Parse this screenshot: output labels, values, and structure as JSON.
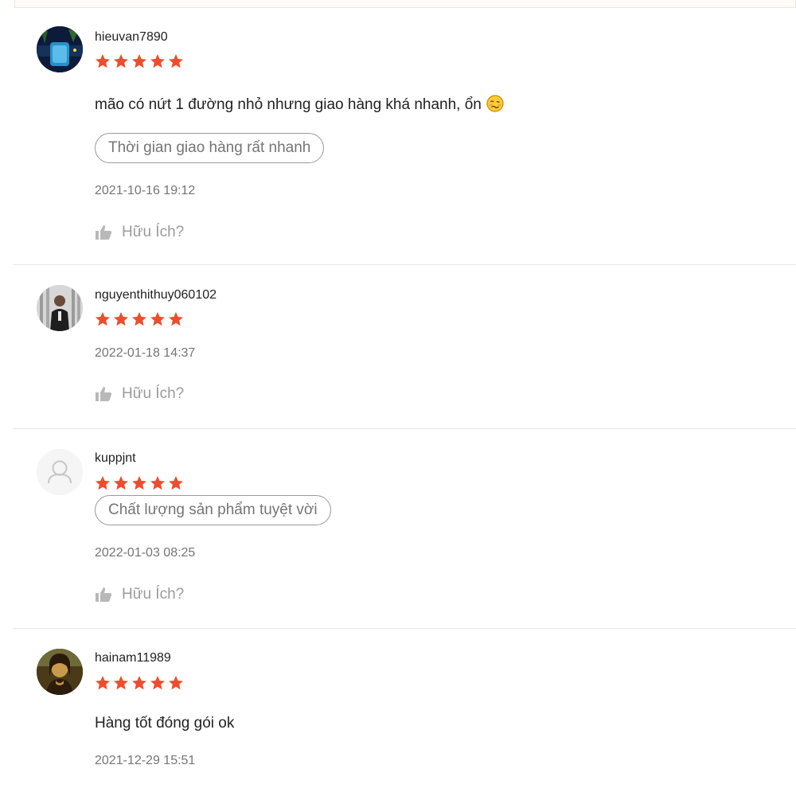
{
  "reviews": [
    {
      "username": "hieuvan7890",
      "rating": 5,
      "comment": "mão có nứt 1 đường nhỏ nhưng giao hàng khá nhanh, ổn",
      "tag": "Thời gian giao hàng rất nhanh",
      "timestamp": "2021-10-16 19:12",
      "helpful_label": "Hữu Ích?"
    },
    {
      "username": "nguyenthithuy060102",
      "rating": 5,
      "timestamp": "2022-01-18 14:37",
      "helpful_label": "Hữu Ích?"
    },
    {
      "username": "kuppjnt",
      "rating": 5,
      "tag": "Chất lượng sản phẩm tuyệt vời",
      "timestamp": "2022-01-03 08:25",
      "helpful_label": "Hữu Ích?"
    },
    {
      "username": "hainam11989",
      "rating": 5,
      "comment": "Hàng tốt đóng gói ok",
      "timestamp": "2021-12-29 15:51"
    }
  ],
  "colors": {
    "star": "#ee4d2d",
    "muted": "#757575",
    "divider": "#e8e8e8"
  },
  "icons": {
    "rating": "star-icon",
    "helpful": "thumbs-up-icon",
    "default_avatar": "user-outline-icon",
    "comment_emoji": "woozy-face-emoji"
  }
}
